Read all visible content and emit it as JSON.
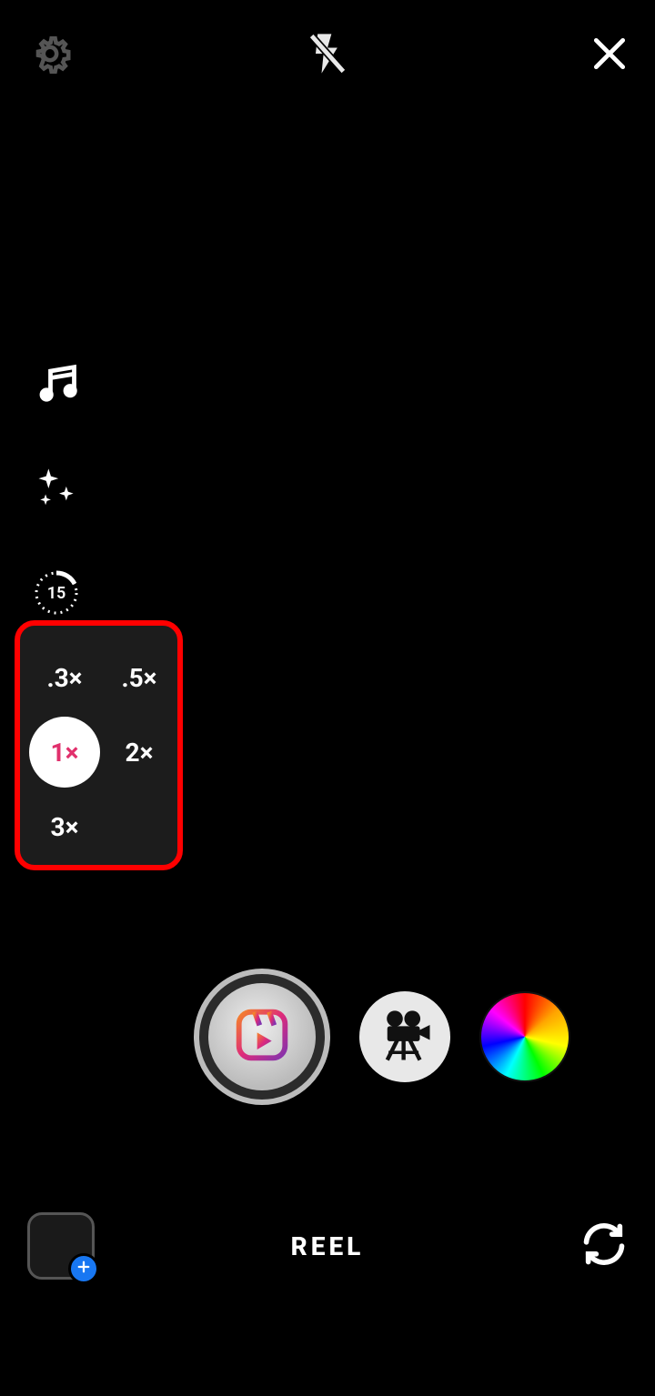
{
  "top": {},
  "tools": {
    "duration_label": "15"
  },
  "speed": {
    "options": [
      {
        "label": ".3×"
      },
      {
        "label": ".5×"
      },
      {
        "label": "1×",
        "selected": true
      },
      {
        "label": "2×"
      },
      {
        "label": "3×"
      }
    ]
  },
  "mode": {
    "current": "REEL"
  }
}
